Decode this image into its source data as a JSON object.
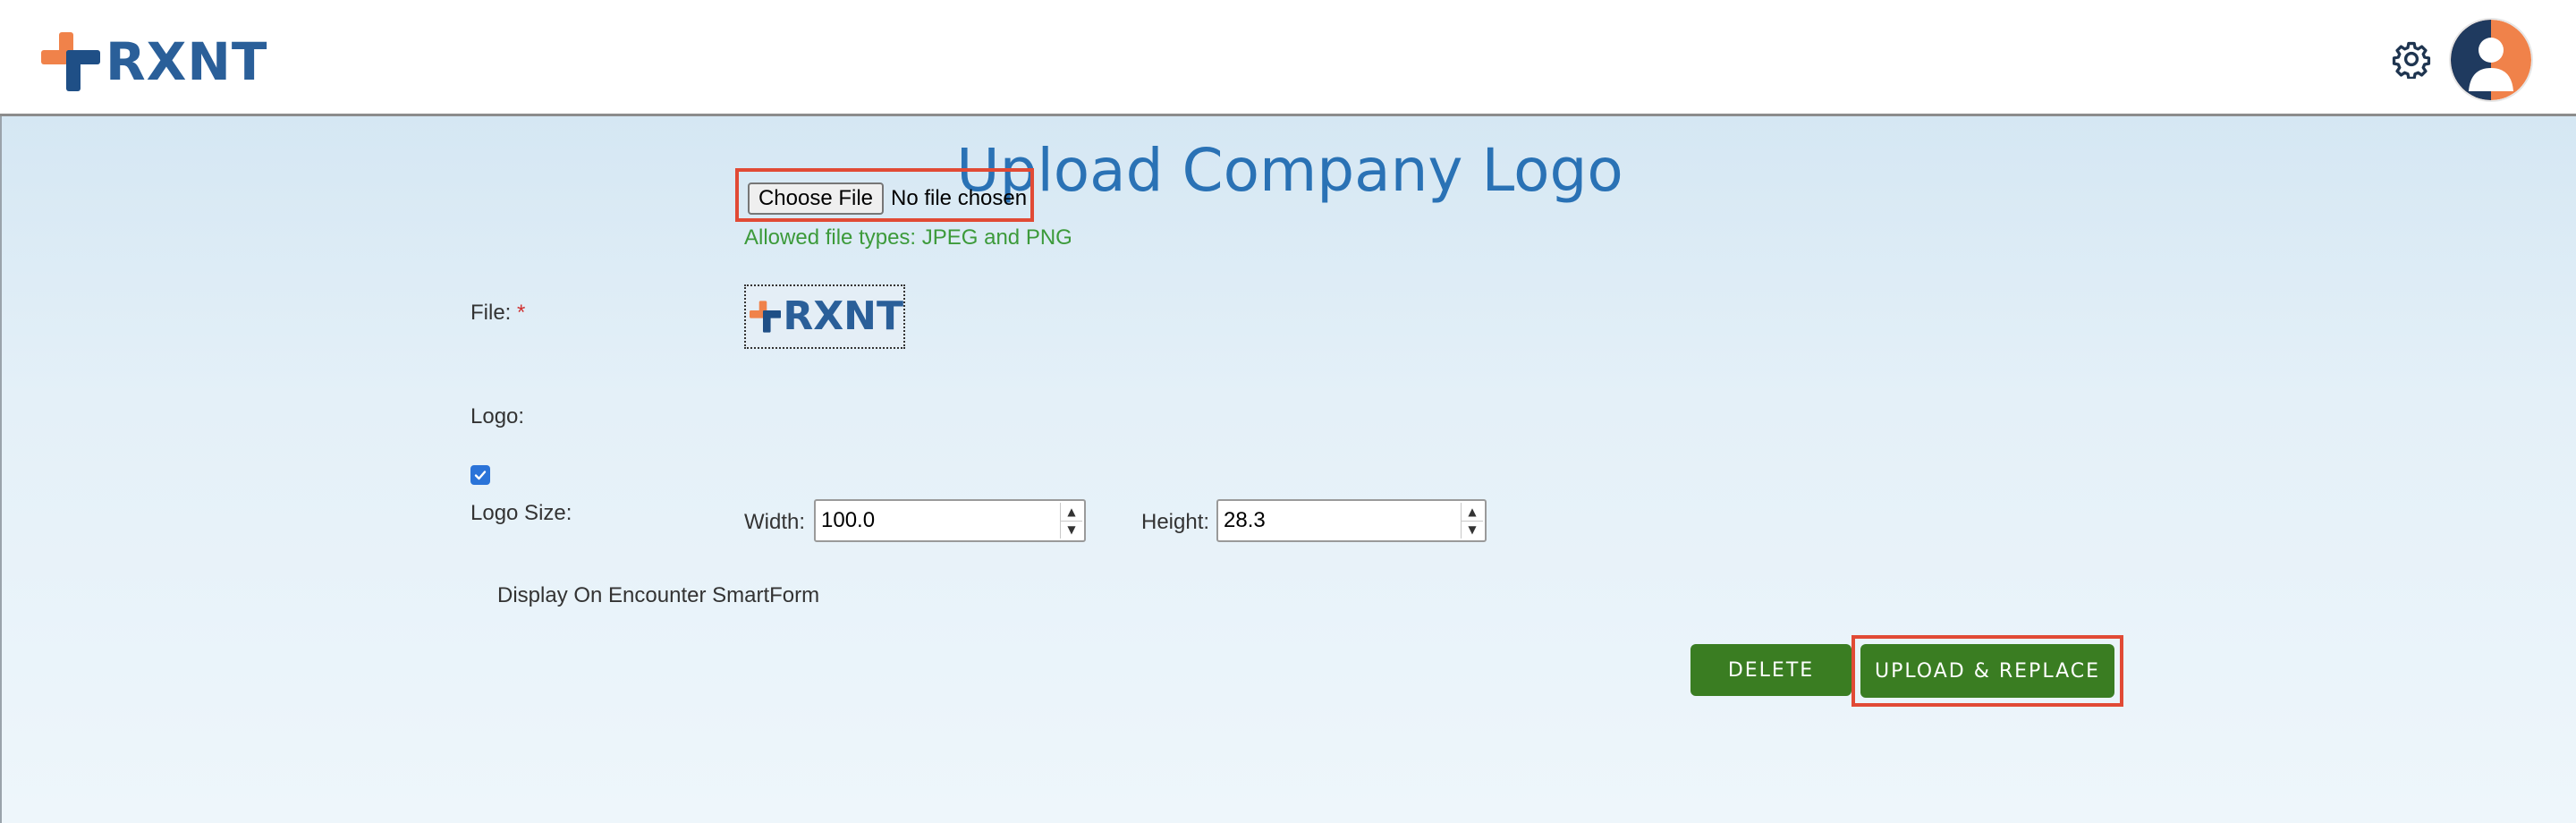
{
  "header": {
    "brand_name": "RXNT",
    "settings_icon": "gear-icon",
    "avatar_icon": "user-avatar-icon"
  },
  "page": {
    "title": "Upload Company Logo"
  },
  "form": {
    "file_label": "File:",
    "required_marker": "*",
    "choose_file_label": "Choose File",
    "file_status": "No file chosen",
    "allowed_types": "Allowed file types: JPEG and PNG",
    "logo_label": "Logo:",
    "logo_preview_text": "RXNT",
    "logo_size_label": "Logo Size:",
    "width_label": "Width:",
    "width_value": "100.0",
    "height_label": "Height:",
    "height_value": "28.3",
    "display_checkbox_checked": true,
    "display_checkbox_label": "Display On Encounter SmartForm"
  },
  "actions": {
    "delete_label": "DELETE",
    "upload_replace_label": "UPLOAD & REPLACE"
  },
  "colors": {
    "brand_blue": "#2a5f99",
    "brand_orange": "#f0824a",
    "title_blue": "#2a72b5",
    "button_green": "#3a7d22",
    "highlight_red": "#e14a35",
    "allowed_green": "#3c9a3a"
  }
}
